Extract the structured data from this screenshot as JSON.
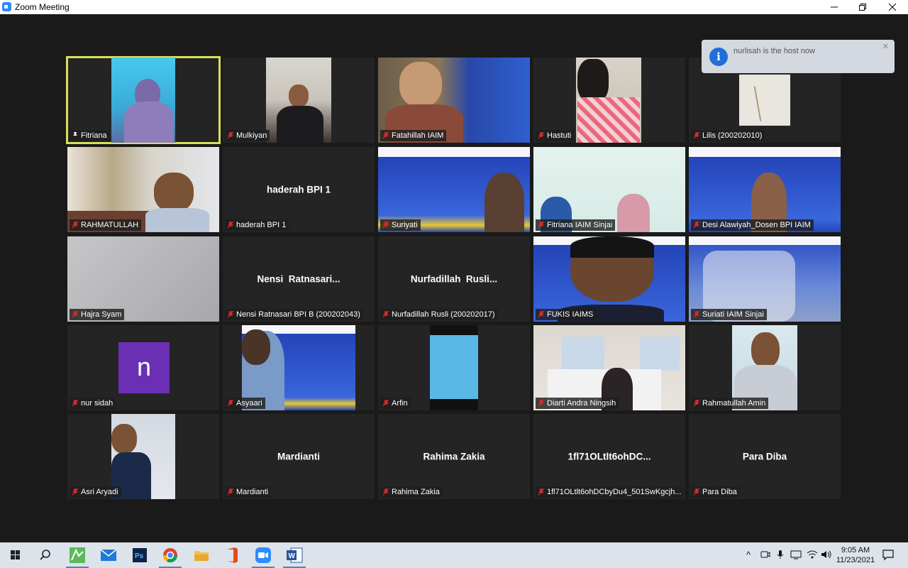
{
  "window": {
    "title": "Zoom Meeting",
    "controls": {
      "minimize": "—",
      "restore": "❐",
      "close": "✕"
    }
  },
  "notification": {
    "text": "nurlisah is the host now",
    "icon": "info-icon",
    "close": "✕"
  },
  "participants": [
    {
      "name": "Fitriana",
      "display": "",
      "pinned": true,
      "muted": false
    },
    {
      "name": "Mulkiyan",
      "display": "",
      "muted": true
    },
    {
      "name": "Fatahillah IAIM",
      "display": "",
      "muted": true
    },
    {
      "name": "Hastuti",
      "display": "",
      "muted": true
    },
    {
      "name": "Lilis (200202010)",
      "display": "",
      "muted": true
    },
    {
      "name": "RAHMATULLAH",
      "display": "",
      "muted": true
    },
    {
      "name": "haderah BPI 1",
      "display": "haderah BPI 1",
      "muted": true
    },
    {
      "name": "Suriyati",
      "display": "",
      "muted": true
    },
    {
      "name": "Fitriana IAIM Sinjai",
      "display": "",
      "muted": true
    },
    {
      "name": "Desi Alawiyah_Dosen BPI IAIM",
      "display": "",
      "muted": true
    },
    {
      "name": "Hajra Syam",
      "display": "",
      "muted": true
    },
    {
      "name": "Nensi Ratnasari  BPI B (200202043)",
      "display": "Nensi  Ratnasari...",
      "muted": true
    },
    {
      "name": "Nurfadillah Rusli (200202017)",
      "display": "Nurfadillah  Rusli...",
      "muted": true
    },
    {
      "name": "FUKIS IAIMS",
      "display": "",
      "muted": true
    },
    {
      "name": "Suriati IAIM Sinjai",
      "display": "",
      "muted": true
    },
    {
      "name": "nur sidah",
      "display": "",
      "avatar_letter": "n",
      "muted": true
    },
    {
      "name": "Asyaari",
      "display": "",
      "muted": true
    },
    {
      "name": "Arfin",
      "display": "",
      "muted": true
    },
    {
      "name": "Diarti Andra Ningsih",
      "display": "",
      "muted": true
    },
    {
      "name": "Rahmatullah Amin",
      "display": "",
      "muted": true
    },
    {
      "name": "Asri Aryadi",
      "display": "",
      "muted": true
    },
    {
      "name": "Mardianti",
      "display": "Mardianti",
      "muted": true
    },
    {
      "name": "Rahima Zakia",
      "display": "Rahima Zakia",
      "muted": true
    },
    {
      "name": "1fl71OLtlt6ohDCbyDu4_501SwKgcjh...",
      "display": "1fl71OLtlt6ohDC...",
      "muted": true
    },
    {
      "name": "Para Diba",
      "display": "Para Diba",
      "muted": true
    }
  ],
  "taskbar": {
    "apps": [
      "windows-start-icon",
      "search-icon",
      "camtasia-icon",
      "mail-icon",
      "photoshop-icon",
      "chrome-icon",
      "file-explorer-icon",
      "office-icon",
      "zoom-icon",
      "word-icon"
    ],
    "time": "9:05 AM",
    "date": "11/23/2021"
  },
  "colors": {
    "active_speaker": "#d7e05b",
    "muted_icon": "#e02828",
    "avatar_bg": "#6b2fb3",
    "info_blue": "#1e6fd9"
  }
}
